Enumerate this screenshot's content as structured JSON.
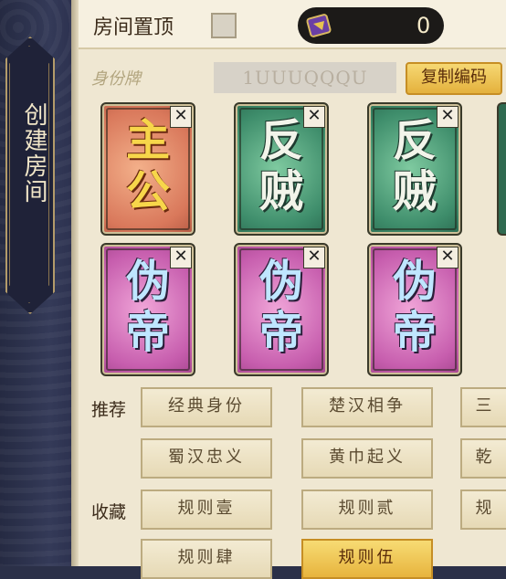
{
  "left_tab": {
    "label": "创建房间"
  },
  "topbar": {
    "pin_label": "房间置顶",
    "currency_value": "0"
  },
  "identity": {
    "label": "身份牌",
    "room_code": "1UUUQQQU",
    "copy_label": "复制编码"
  },
  "cards": [
    {
      "role": "lord",
      "line1": "主",
      "line2": "公"
    },
    {
      "role": "rebel",
      "line1": "反",
      "line2": "贼"
    },
    {
      "role": "rebel",
      "line1": "反",
      "line2": "贼"
    },
    {
      "role": "usurper",
      "line1": "伪",
      "line2": "帝"
    },
    {
      "role": "usurper",
      "line1": "伪",
      "line2": "帝"
    },
    {
      "role": "usurper",
      "line1": "伪",
      "line2": "帝"
    }
  ],
  "card_close_glyph": "✕",
  "recommend": {
    "label": "推荐",
    "items": [
      "经典身份",
      "楚汉相争",
      "三",
      "蜀汉忠义",
      "黄巾起义",
      "乾"
    ]
  },
  "favorites": {
    "label": "收藏",
    "items": [
      "规则壹",
      "规则贰",
      "规",
      "规则肆",
      "规则伍"
    ],
    "active_index": 4
  },
  "colors": {
    "accent_gold": "#e7b43d",
    "panel": "#efe7d2",
    "rail": "#2b3048"
  }
}
